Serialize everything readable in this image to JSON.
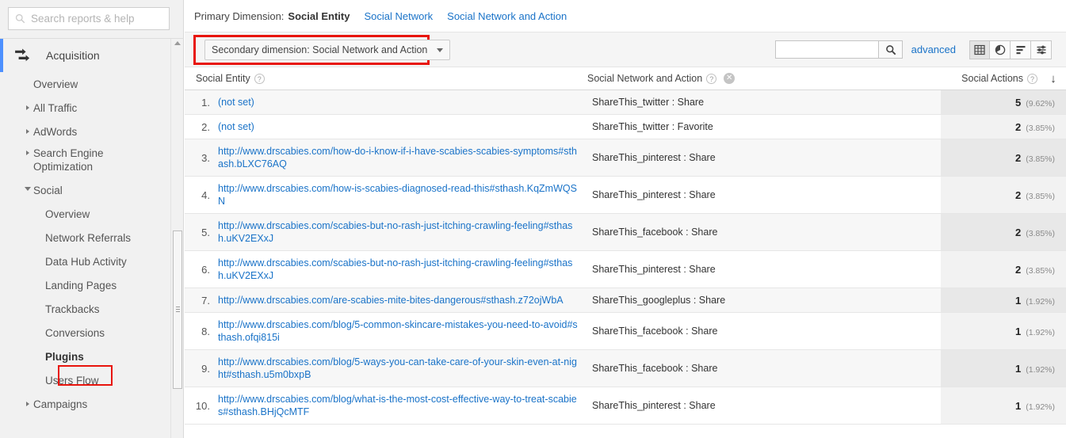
{
  "sidebar": {
    "search": {
      "placeholder": "Search reports & help",
      "value": "",
      "icon": "search-icon"
    },
    "section": {
      "label": "Acquisition",
      "icon": "acquisition-arrows-icon"
    },
    "items": [
      {
        "label": "Overview",
        "level": 1,
        "expandable": false
      },
      {
        "label": "All Traffic",
        "level": 1,
        "expandable": true,
        "expanded": false
      },
      {
        "label": "AdWords",
        "level": 1,
        "expandable": true,
        "expanded": false
      },
      {
        "label": "Search Engine Optimization",
        "level": 1,
        "expandable": true,
        "expanded": false
      },
      {
        "label": "Social",
        "level": 1,
        "expandable": true,
        "expanded": true
      },
      {
        "label": "Overview",
        "level": 2
      },
      {
        "label": "Network Referrals",
        "level": 2
      },
      {
        "label": "Data Hub Activity",
        "level": 2
      },
      {
        "label": "Landing Pages",
        "level": 2
      },
      {
        "label": "Trackbacks",
        "level": 2
      },
      {
        "label": "Conversions",
        "level": 2
      },
      {
        "label": "Plugins",
        "level": 2,
        "selected": true,
        "highlighted": true
      },
      {
        "label": "Users Flow",
        "level": 2
      },
      {
        "label": "Campaigns",
        "level": 1,
        "expandable": true,
        "expanded": false
      }
    ]
  },
  "primary_dimension": {
    "label": "Primary Dimension:",
    "active": "Social Entity",
    "links": [
      "Social Network",
      "Social Network and Action"
    ]
  },
  "toolbar": {
    "secondary_dimension_label": "Secondary dimension: Social Network and Action",
    "search_value": "",
    "search_placeholder": "",
    "advanced_label": "advanced",
    "views": [
      {
        "name": "table-view",
        "active": true
      },
      {
        "name": "pie-view",
        "active": false
      },
      {
        "name": "performance-view",
        "active": false
      },
      {
        "name": "pivot-view",
        "active": false
      }
    ]
  },
  "table": {
    "columns": {
      "entity": "Social Entity",
      "network": "Social Network and Action",
      "actions": "Social Actions"
    },
    "rows": [
      {
        "n": "1.",
        "entity": "(not set)",
        "network": "ShareThis_twitter : Share",
        "value": "5",
        "pct": "(9.62%)"
      },
      {
        "n": "2.",
        "entity": "(not set)",
        "network": "ShareThis_twitter : Favorite",
        "value": "2",
        "pct": "(3.85%)"
      },
      {
        "n": "3.",
        "entity": "http://www.drscabies.com/how-do-i-know-if-i-have-scabies-scabies-symptoms#sthash.bLXC76AQ",
        "network": "ShareThis_pinterest : Share",
        "value": "2",
        "pct": "(3.85%)"
      },
      {
        "n": "4.",
        "entity": "http://www.drscabies.com/how-is-scabies-diagnosed-read-this#sthash.KqZmWQSN",
        "network": "ShareThis_pinterest : Share",
        "value": "2",
        "pct": "(3.85%)"
      },
      {
        "n": "5.",
        "entity": "http://www.drscabies.com/scabies-but-no-rash-just-itching-crawling-feeling#sthash.uKV2EXxJ",
        "network": "ShareThis_facebook : Share",
        "value": "2",
        "pct": "(3.85%)"
      },
      {
        "n": "6.",
        "entity": "http://www.drscabies.com/scabies-but-no-rash-just-itching-crawling-feeling#sthash.uKV2EXxJ",
        "network": "ShareThis_pinterest : Share",
        "value": "2",
        "pct": "(3.85%)"
      },
      {
        "n": "7.",
        "entity": "http://www.drscabies.com/are-scabies-mite-bites-dangerous#sthash.z72ojWbA",
        "network": "ShareThis_googleplus : Share",
        "value": "1",
        "pct": "(1.92%)"
      },
      {
        "n": "8.",
        "entity": "http://www.drscabies.com/blog/5-common-skincare-mistakes-you-need-to-avoid#sthash.ofqi815i",
        "network": "ShareThis_facebook : Share",
        "value": "1",
        "pct": "(1.92%)"
      },
      {
        "n": "9.",
        "entity": "http://www.drscabies.com/blog/5-ways-you-can-take-care-of-your-skin-even-at-night#sthash.u5m0bxpB",
        "network": "ShareThis_facebook : Share",
        "value": "1",
        "pct": "(1.92%)"
      },
      {
        "n": "10.",
        "entity": "http://www.drscabies.com/blog/what-is-the-most-cost-effective-way-to-treat-scabies#sthash.BHjQcMTF",
        "network": "ShareThis_pinterest : Share",
        "value": "1",
        "pct": "(1.92%)"
      }
    ]
  },
  "colors": {
    "link": "#1a73c8",
    "highlight": "#e8140c",
    "accent": "#4d90fe"
  }
}
